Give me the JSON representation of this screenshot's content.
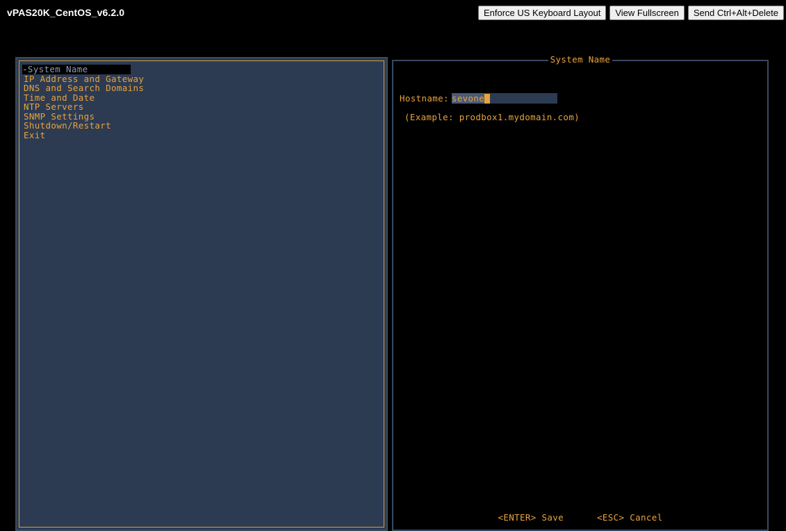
{
  "toolbar": {
    "vm_title": "vPAS20K_CentOS_v6.2.0",
    "buttons": [
      {
        "label": "Enforce US Keyboard Layout",
        "name": "enforce-us-keyboard-layout-button"
      },
      {
        "label": "View Fullscreen",
        "name": "view-fullscreen-button"
      },
      {
        "label": "Send Ctrl+Alt+Delete",
        "name": "send-ctrl-alt-delete-button"
      }
    ]
  },
  "menu": {
    "selected_index": 0,
    "selected_marker": "-",
    "items": [
      {
        "label": "System Name"
      },
      {
        "label": "IP Address and Gateway"
      },
      {
        "label": "DNS and Search Domains"
      },
      {
        "label": "Time and Date"
      },
      {
        "label": "NTP Servers"
      },
      {
        "label": "SNMP Settings"
      },
      {
        "label": "Shutdown/Restart"
      },
      {
        "label": "Exit"
      }
    ]
  },
  "detail": {
    "title": "System Name",
    "field_label": "Hostname:",
    "field_value": "sevone",
    "example": "(Example: prodbox1.mydomain.com)",
    "actions": [
      {
        "label": "<ENTER> Save"
      },
      {
        "label": "<ESC> Cancel"
      }
    ]
  },
  "colors": {
    "accent_orange": "#e8a33d",
    "panel_blue": "#2d3b52",
    "panel_border_blue": "#3a4a64",
    "selected_text": "#8c9bb4",
    "background": "#000000",
    "input_highlight": "#4a5b76"
  }
}
